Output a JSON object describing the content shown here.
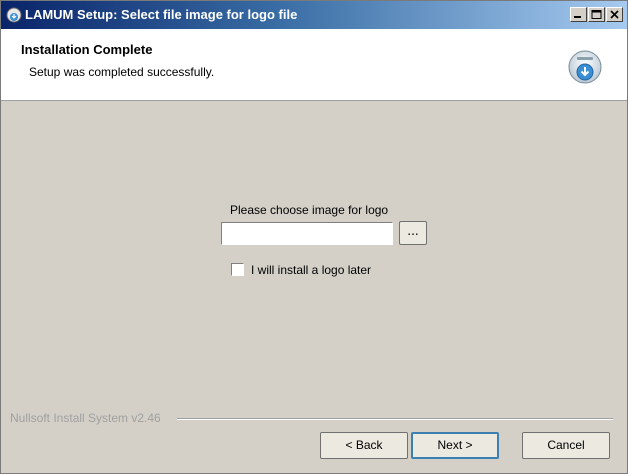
{
  "window": {
    "title": "LAMUM Setup: Select file image for logo file"
  },
  "header": {
    "title": "Installation Complete",
    "subtitle": "Setup was completed successfully."
  },
  "main": {
    "prompt": "Please choose image for logo",
    "file_input": {
      "value": "",
      "placeholder": ""
    },
    "browse_label": "...",
    "later_checkbox": {
      "label": "I will install a logo later",
      "checked": false
    }
  },
  "footer": {
    "brand": "Nullsoft Install System v2.46",
    "back_label": "< Back",
    "next_label": "Next >",
    "cancel_label": "Cancel"
  },
  "colors": {
    "titlebar_start": "#0a246a",
    "titlebar_end": "#a6caf0",
    "dialog_bg": "#d4d0c8",
    "default_button_border": "#3c7fb1"
  },
  "icons": {
    "title": "installer-icon",
    "header": "setup-disk-icon"
  }
}
